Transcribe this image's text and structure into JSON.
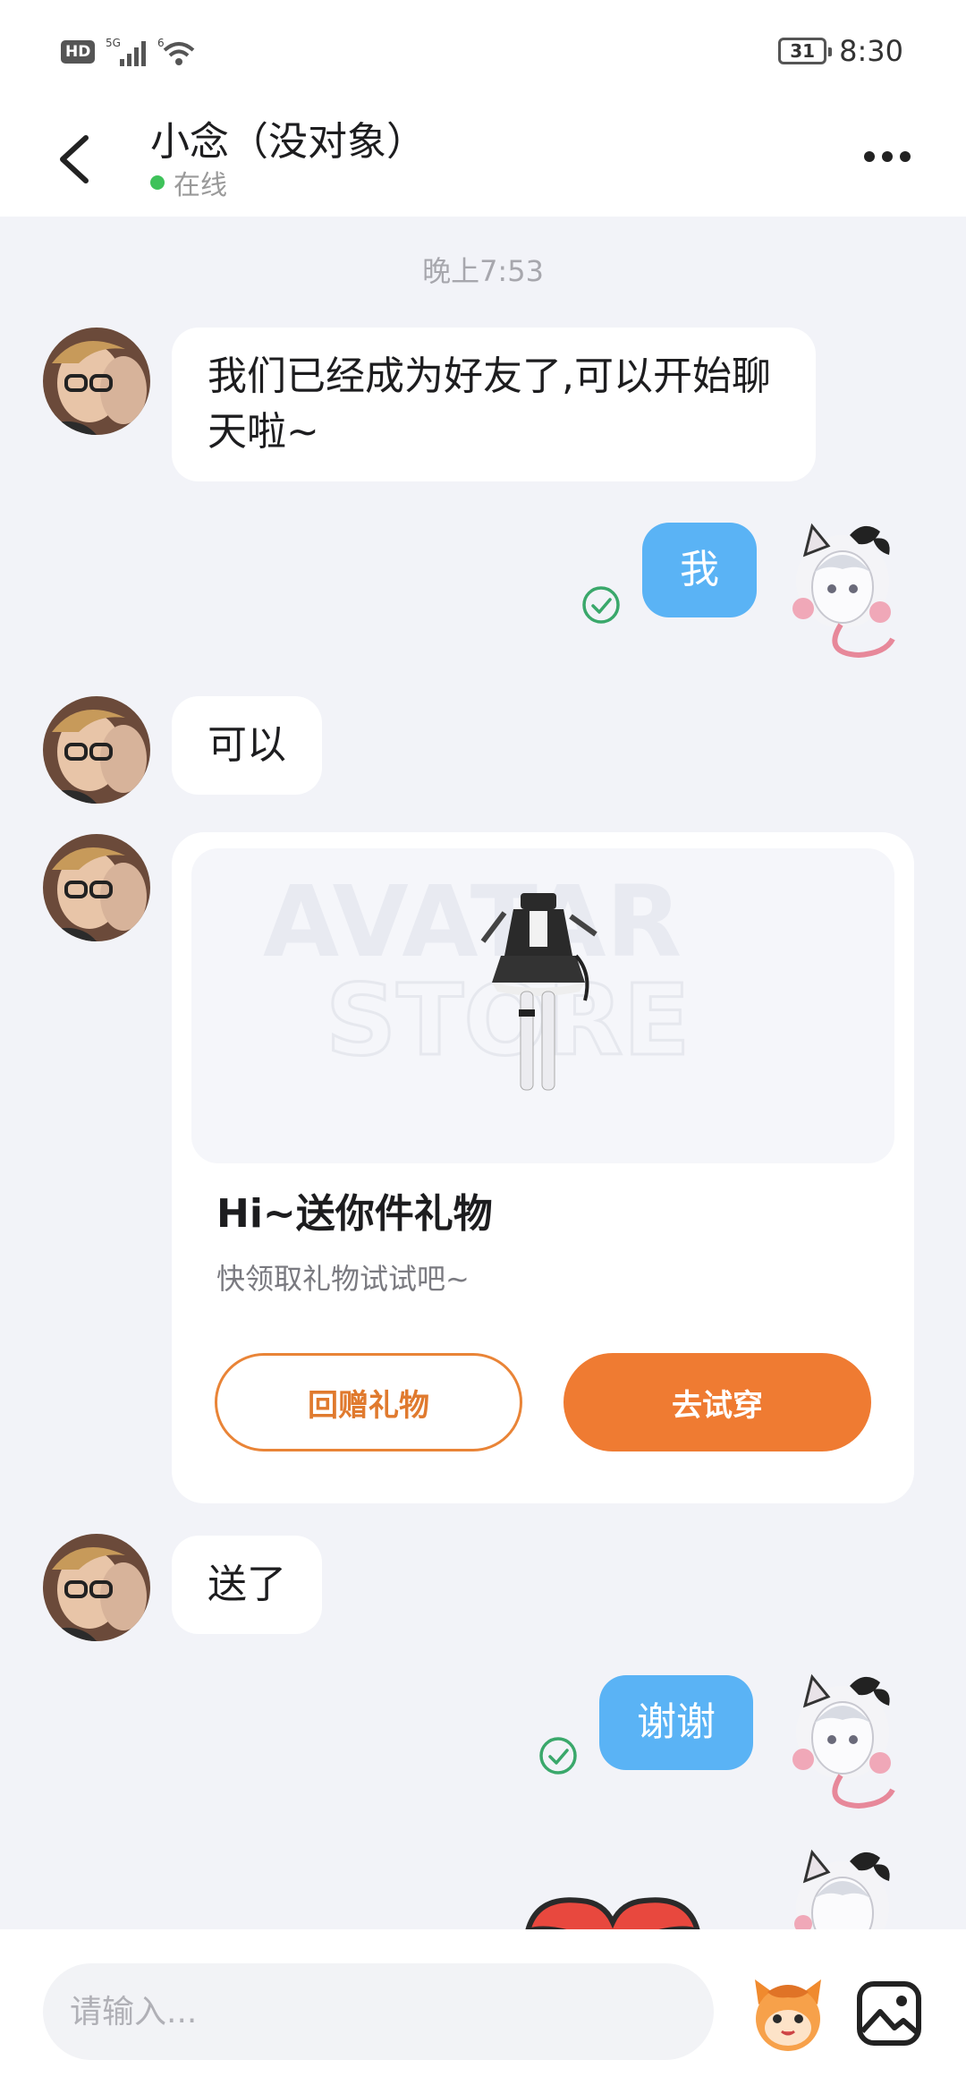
{
  "status_bar": {
    "hd_label": "HD",
    "signal_label": "5G",
    "wifi_label": "6",
    "battery": "31",
    "time": "8:30"
  },
  "header": {
    "title": "小念（没对象）",
    "status": "在线"
  },
  "chat": {
    "timestamp": "晚上7:53",
    "messages": [
      {
        "from": "other",
        "text": "我们已经成为好友了,可以开始聊天啦~"
      },
      {
        "from": "me",
        "text": "我"
      },
      {
        "from": "other",
        "text": "可以"
      },
      {
        "from": "other",
        "text": "送了"
      },
      {
        "from": "me",
        "text": "谢谢"
      }
    ],
    "gift_card": {
      "watermark_line1": "AVATAR",
      "watermark_line2": "STORE",
      "title": "Hi~送你件礼物",
      "subtitle": "快领取礼物试试吧~",
      "return_button": "回赠礼物",
      "try_button": "去试穿"
    }
  },
  "input": {
    "placeholder": "请输入..."
  },
  "colors": {
    "accent_blue": "#5ab3f5",
    "accent_orange": "#ef7b32",
    "online_green": "#3ec25a",
    "check_green": "#3aa86b",
    "background": "#f2f3f8"
  }
}
